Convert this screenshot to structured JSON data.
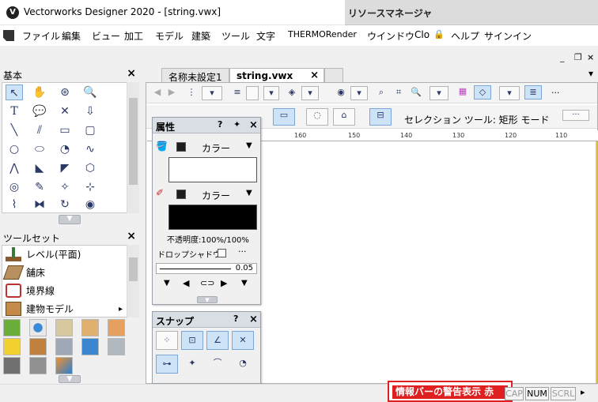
{
  "window": {
    "title": "Vectorworks Designer 2020 - [string.vwx]"
  },
  "resource_manager": {
    "title": "リソースマネージャ"
  },
  "menu": [
    "ファイル",
    "編集",
    "ビュー",
    "加工",
    "モデル",
    "建築",
    "ツール",
    "文字",
    "THERMORender",
    "ウインドウ",
    "Clo",
    "ヘルプ",
    "サインイン"
  ],
  "window_controls": {
    "min": "_",
    "restore": "❐",
    "close": "×"
  },
  "basic_panel": {
    "title": "基本",
    "close": "×"
  },
  "toolset_panel": {
    "title": "ツールセット",
    "close": "×",
    "items": [
      {
        "label": "レベル(平面)"
      },
      {
        "label": "舗床"
      },
      {
        "label": "境界線"
      },
      {
        "label": "建物モデル"
      }
    ],
    "expand_arrow": "▸"
  },
  "tabs": [
    {
      "label": "名称未設定1"
    },
    {
      "label": "string.vwx",
      "close": "×"
    }
  ],
  "tab_menu_arrow": "▾",
  "toolbar": {
    "mode_label": "セレクション ツール: 矩形 モード",
    "more": "···"
  },
  "ruler": {
    "ticks": [
      "160",
      "150",
      "140",
      "130",
      "120",
      "110"
    ]
  },
  "attributes_palette": {
    "title": "属性",
    "help": "?",
    "pin": "✦",
    "close": "×",
    "fill_label": "カラー",
    "pen_label": "カラー",
    "opacity": "不透明度:100%/100%",
    "drop_shadow": "ドロップシャドウ",
    "more": "···",
    "line_weight": "0.05",
    "fill_color": "#ffffff",
    "pen_color": "#000000"
  },
  "snap_palette": {
    "title": "スナップ",
    "help": "?",
    "close": "×"
  },
  "status": {
    "warning": "情報バーの警告表示 赤",
    "caps": "CAP",
    "num": "NUM",
    "scrl": "SCRL",
    "arrow": "▸"
  }
}
